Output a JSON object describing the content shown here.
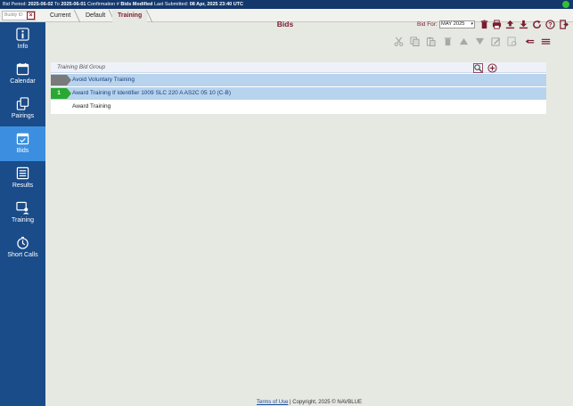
{
  "topbar": {
    "bid_period_label": "Bid Period:",
    "bid_period_start": "2025-06-02",
    "to_label": "To",
    "bid_period_end": "2025-06-01",
    "confirmation_label": "Confirmation #",
    "status": "Bids Modified",
    "last_submitted_label": "Last Submitted:",
    "last_submitted_value": "08 Apr, 2025 23:40 UTC",
    "status_color": "#2fbf3a"
  },
  "tabbar": {
    "buddy_placeholder": "Buddy ID",
    "tabs": [
      {
        "label": "Current"
      },
      {
        "label": "Default"
      },
      {
        "label": "Training"
      }
    ],
    "active_tab": "Training",
    "page_title": "Bids",
    "bid_for_label": "Bid For:",
    "bid_for_value": "MAY 2025",
    "icons": [
      "trash-icon",
      "print-icon",
      "upload-icon",
      "download-icon",
      "refresh-icon",
      "help-icon",
      "exit-icon"
    ]
  },
  "sidebar": {
    "items": [
      {
        "label": "Info",
        "icon": "info-icon"
      },
      {
        "label": "Calendar",
        "icon": "calendar-icon"
      },
      {
        "label": "Pairings",
        "icon": "pairings-icon"
      },
      {
        "label": "Bids",
        "icon": "bids-icon",
        "active": true
      },
      {
        "label": "Results",
        "icon": "results-icon"
      },
      {
        "label": "Training",
        "icon": "training-icon"
      },
      {
        "label": "Short Calls",
        "icon": "short-calls-icon"
      }
    ],
    "bg_color": "#1a4c8a",
    "active_color": "#3c8fe0"
  },
  "toolbar": {
    "icons": [
      "cut-icon",
      "copy-icon",
      "paste-icon",
      "delete-icon",
      "move-up-icon",
      "move-down-icon",
      "edit-icon",
      "validate-icon",
      "collapse-icon",
      "expand-icon"
    ]
  },
  "panel": {
    "title": "Training Bid Group",
    "rows": [
      {
        "number": "",
        "text": "Avoid Voluntary Training",
        "selected": true,
        "marker_color": "#7a7a7a"
      },
      {
        "number": "1",
        "text": "Award Training If Identifier 1009 SLC 220 A AS2C 05 10 (C-B)",
        "selected": true,
        "marker_color": "#2aa832"
      },
      {
        "number": "",
        "text": "Award Training",
        "selected": false
      }
    ]
  },
  "footer": {
    "terms": "Terms of Use",
    "copyright": "| Copyright, 2025 © NAVBLUE"
  },
  "colors": {
    "brand_dark": "#14386c",
    "accent_red": "#7a1c2e",
    "selection": "#b7d3ee"
  }
}
